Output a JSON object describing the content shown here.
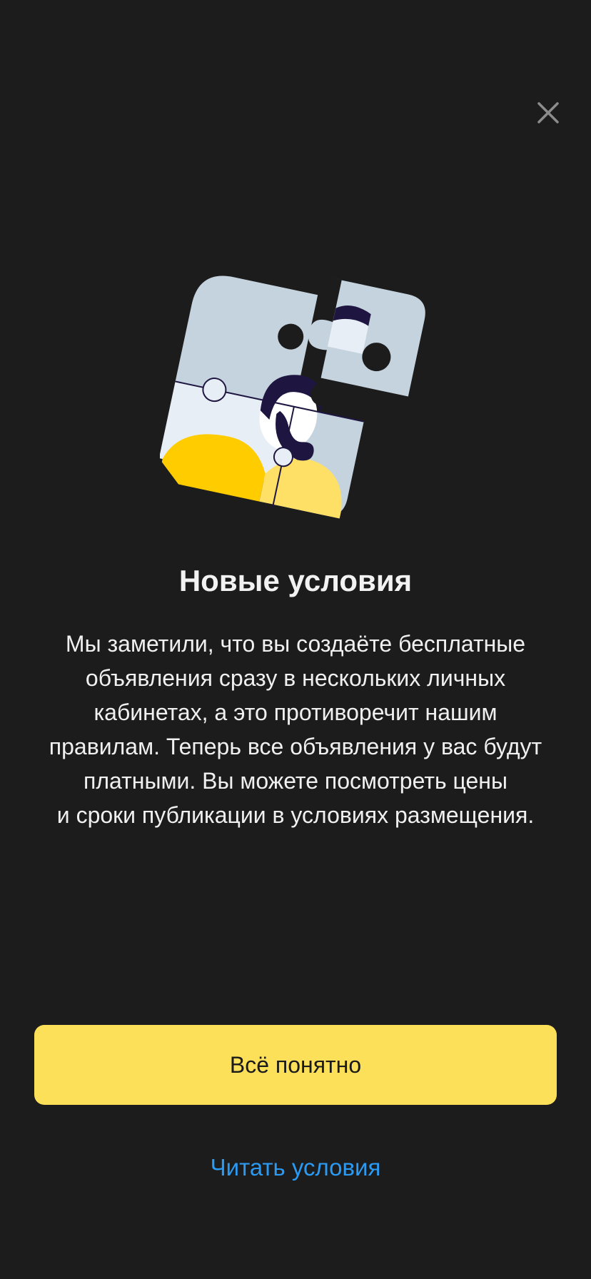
{
  "dialog": {
    "close_icon": "close-icon",
    "illustration_icon": "puzzle-illustration",
    "title": "Новые условия",
    "body_lines": [
      "Мы заметили, что вы создаёте бесплатные",
      "объявления сразу в нескольких личных",
      "кабинетах, а это противоречит нашим",
      "правилам. Теперь все объявления у вас будут",
      "платными. Вы можете посмотреть цены",
      "и сроки публикации в условиях размещения."
    ],
    "primary_button_label": "Всё понятно",
    "secondary_link_label": "Читать условия"
  },
  "colors": {
    "background": "#1c1c1c",
    "primary_button": "#fde05a",
    "link": "#2b9af3",
    "close_icon": "#8c8c8c"
  }
}
